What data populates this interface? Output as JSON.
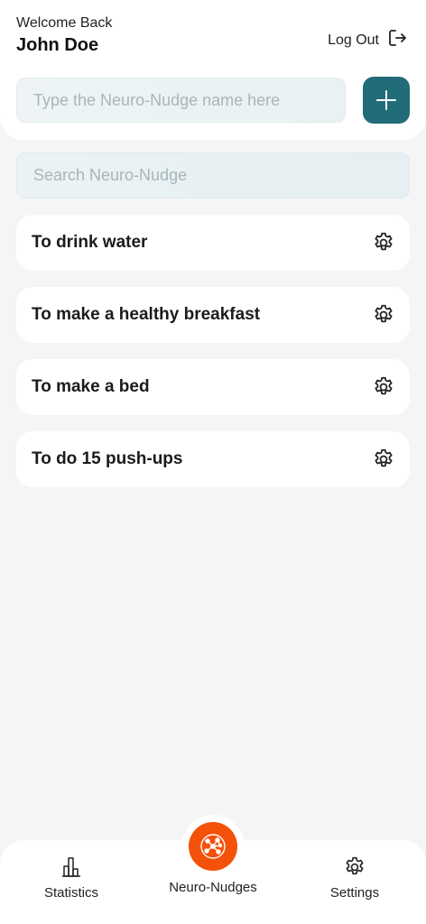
{
  "header": {
    "welcome": "Welcome Back",
    "username": "John Doe",
    "logout_label": "Log Out"
  },
  "create": {
    "placeholder": "Type the Neuro-Nudge name here",
    "add_icon": "plus-icon"
  },
  "search": {
    "placeholder": "Search Neuro-Nudge"
  },
  "nudges": [
    {
      "title": "To drink water",
      "icon": "gear-icon"
    },
    {
      "title": "To make a healthy breakfast",
      "icon": "gear-icon"
    },
    {
      "title": "To make a bed",
      "icon": "gear-icon"
    },
    {
      "title": "To do 15 push-ups",
      "icon": "gear-icon"
    }
  ],
  "nav": {
    "statistics": "Statistics",
    "neuro_nudges": "Neuro-Nudges",
    "settings": "Settings",
    "active": "neuro_nudges"
  },
  "colors": {
    "accent": "#216c78",
    "fab": "#f4510b",
    "background": "#f5f5f5"
  }
}
